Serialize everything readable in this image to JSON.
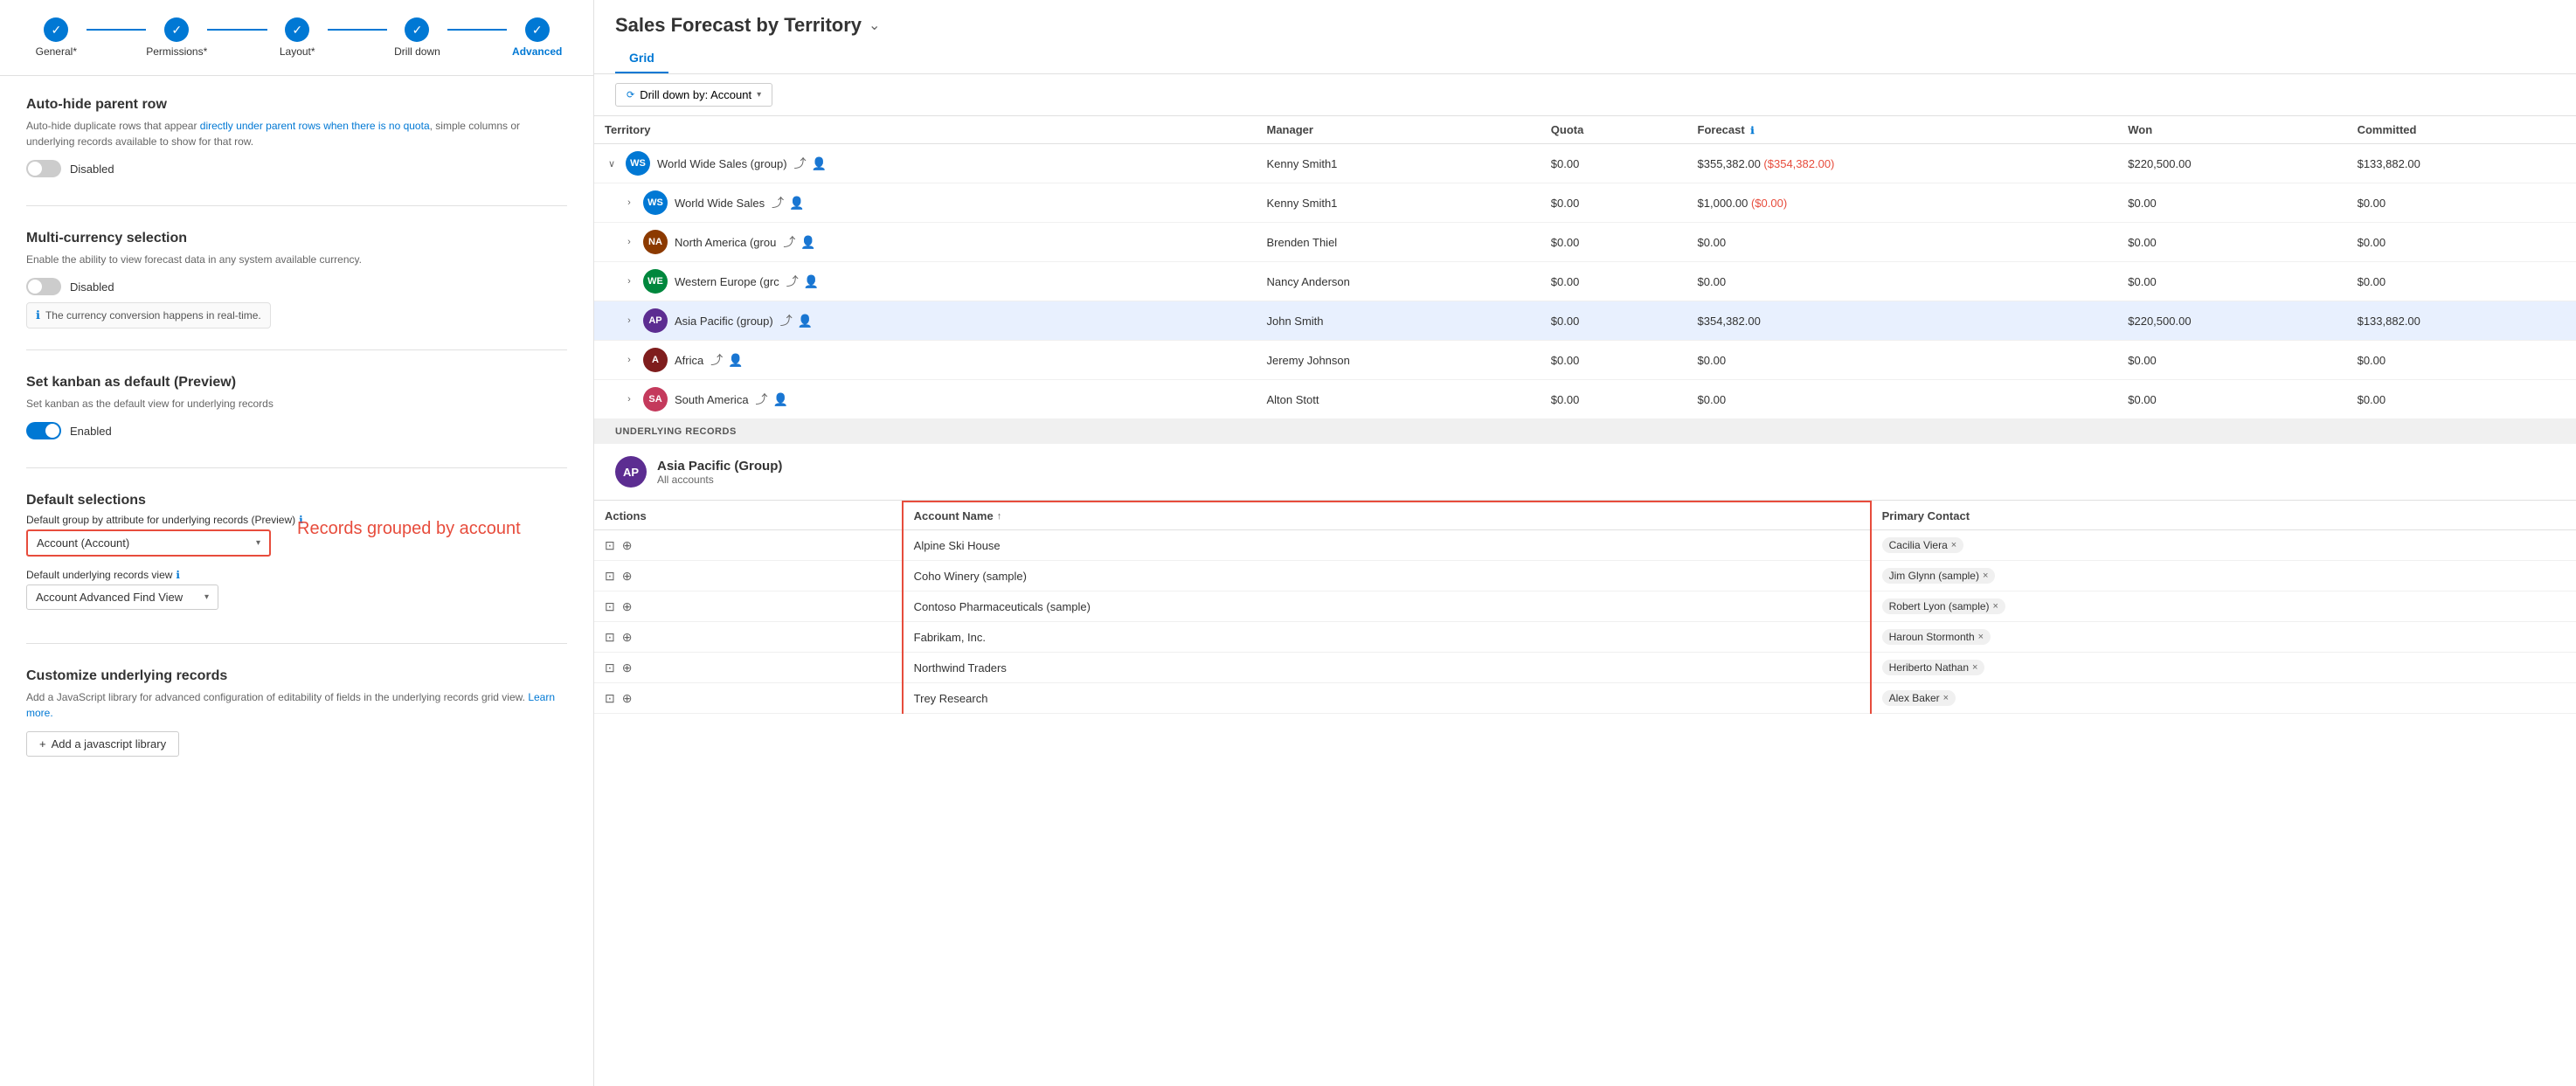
{
  "wizard": {
    "steps": [
      {
        "id": "general",
        "label": "General*",
        "completed": true
      },
      {
        "id": "permissions",
        "label": "Permissions*",
        "completed": true
      },
      {
        "id": "layout",
        "label": "Layout*",
        "completed": true
      },
      {
        "id": "drilldown",
        "label": "Drill down",
        "completed": true
      },
      {
        "id": "advanced",
        "label": "Advanced",
        "completed": false,
        "active": true
      }
    ]
  },
  "sections": {
    "auto_hide": {
      "title": "Auto-hide parent row",
      "desc": "Auto-hide duplicate rows that appear directly under parent rows when there is no quota, simple columns or underlying records available to show for that row.",
      "toggle_state": "Disabled",
      "toggle_on": false
    },
    "multi_currency": {
      "title": "Multi-currency selection",
      "desc": "Enable the ability to view forecast data in any system available currency.",
      "toggle_state": "Disabled",
      "toggle_on": false,
      "info_text": "The currency conversion happens in real-time."
    },
    "kanban": {
      "title": "Set kanban as default (Preview)",
      "desc": "Set kanban as the default view for underlying records",
      "toggle_state": "Enabled",
      "toggle_on": true
    },
    "default_selections": {
      "title": "Default selections",
      "field1_label": "Default group by attribute for underlying records (Preview)",
      "field1_value": "Account (Account)",
      "field2_label": "Default underlying records view",
      "field2_value": "Account Advanced Find View"
    },
    "customize": {
      "title": "Customize underlying records",
      "desc": "Add a JavaScript library for advanced configuration of editability of fields in the underlying records grid view.",
      "learn_more": "Learn more.",
      "add_btn": "Add a javascript library"
    }
  },
  "annotation": {
    "text": "Records grouped by account"
  },
  "right": {
    "title": "Sales Forecast by Territory",
    "tabs": [
      {
        "id": "grid",
        "label": "Grid",
        "active": true
      }
    ],
    "drill_btn": "Drill down by: Account",
    "table": {
      "columns": [
        {
          "id": "territory",
          "label": "Territory"
        },
        {
          "id": "manager",
          "label": "Manager"
        },
        {
          "id": "quota",
          "label": "Quota"
        },
        {
          "id": "forecast",
          "label": "Forecast"
        },
        {
          "id": "won",
          "label": "Won"
        },
        {
          "id": "committed",
          "label": "Committed"
        }
      ],
      "rows": [
        {
          "id": "wws-group",
          "indent": 0,
          "expanded": true,
          "avatar_text": "WS",
          "avatar_color": "#0078d4",
          "name": "World Wide Sales (group)",
          "manager": "Kenny Smith1",
          "quota": "$0.00",
          "forecast": "$355,382.00 ($354,382.00)",
          "forecast_negative": true,
          "won": "$220,500.00",
          "committed": "$133,882.00"
        },
        {
          "id": "wws",
          "indent": 1,
          "expanded": false,
          "avatar_text": "WS",
          "avatar_color": "#0078d4",
          "name": "World Wide Sales",
          "manager": "Kenny Smith1",
          "quota": "$0.00",
          "forecast": "$1,000.00 ($0.00)",
          "won": "$0.00",
          "committed": "$0.00"
        },
        {
          "id": "na-group",
          "indent": 1,
          "expanded": false,
          "avatar_text": "NA",
          "avatar_color": "#8c3a00",
          "name": "North America (grou",
          "manager": "Brenden Thiel",
          "quota": "$0.00",
          "forecast": "$0.00",
          "won": "$0.00",
          "committed": "$0.00"
        },
        {
          "id": "we-group",
          "indent": 1,
          "expanded": false,
          "avatar_text": "WE",
          "avatar_color": "#00873d",
          "name": "Western Europe (grc",
          "manager": "Nancy Anderson",
          "quota": "$0.00",
          "forecast": "$0.00",
          "won": "$0.00",
          "committed": "$0.00"
        },
        {
          "id": "ap-group",
          "indent": 1,
          "expanded": false,
          "highlighted": true,
          "avatar_text": "AP",
          "avatar_color": "#5c2d91",
          "name": "Asia Pacific (group)",
          "manager": "John Smith",
          "quota": "$0.00",
          "forecast": "$354,382.00",
          "won": "$220,500.00",
          "committed": "$133,882.00"
        },
        {
          "id": "africa",
          "indent": 1,
          "expanded": false,
          "avatar_text": "A",
          "avatar_color": "#7f1d1d",
          "name": "Africa",
          "manager": "Jeremy Johnson",
          "quota": "$0.00",
          "forecast": "$0.00",
          "won": "$0.00",
          "committed": "$0.00"
        },
        {
          "id": "sa",
          "indent": 1,
          "expanded": false,
          "avatar_text": "SA",
          "avatar_color": "#c43a5c",
          "name": "South America",
          "manager": "Alton Stott",
          "quota": "$0.00",
          "forecast": "$0.00",
          "won": "$0.00",
          "committed": "$0.00"
        }
      ]
    },
    "underlying": {
      "header": "UNDERLYING RECORDS",
      "avatar_text": "AP",
      "avatar_color": "#5c2d91",
      "name": "Asia Pacific (Group)",
      "sub": "All accounts",
      "table_cols": [
        {
          "id": "actions",
          "label": "Actions"
        },
        {
          "id": "account_name",
          "label": "Account Name",
          "sort": "asc"
        },
        {
          "id": "primary_contact",
          "label": "Primary Contact"
        }
      ],
      "rows": [
        {
          "account": "Alpine Ski House",
          "contact": "Cacilia Viera"
        },
        {
          "account": "Coho Winery (sample)",
          "contact": "Jim Glynn (sample)"
        },
        {
          "account": "Contoso Pharmaceuticals (sample)",
          "contact": "Robert Lyon (sample)"
        },
        {
          "account": "Fabrikam, Inc.",
          "contact": "Haroun Stormonth"
        },
        {
          "account": "Northwind Traders",
          "contact": "Heriberto Nathan"
        },
        {
          "account": "Trey Research",
          "contact": "Alex Baker"
        }
      ]
    }
  }
}
